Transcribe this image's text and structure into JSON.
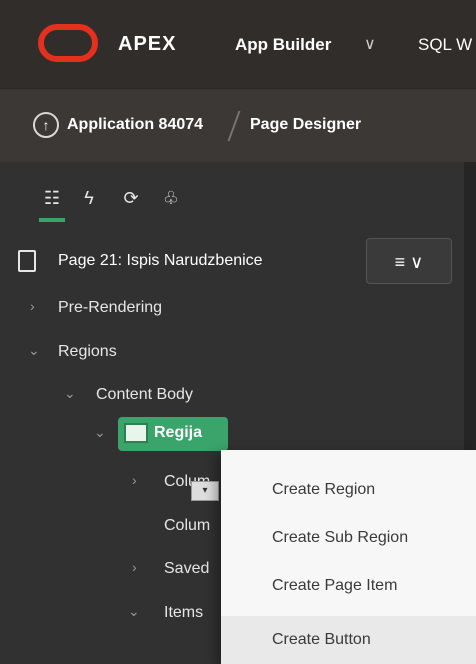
{
  "topbar": {
    "product": "APEX",
    "app_builder": "App Builder",
    "app_builder_chevron": "∨",
    "sql": "SQL W"
  },
  "breadcrumb": {
    "up_symbol": "↑",
    "application": "Application 84074",
    "current": "Page Designer"
  },
  "tabs": [
    {
      "icon": "rendering-tree-icon",
      "glyph": "☷"
    },
    {
      "icon": "dynamic-actions-icon",
      "glyph": "ϟ"
    },
    {
      "icon": "processing-icon",
      "glyph": "⟳"
    },
    {
      "icon": "shared-components-icon",
      "glyph": "♧"
    }
  ],
  "tree": {
    "page_title": "Page 21: Ispis Narudzbenice",
    "menu_button_glyph": "≡ ∨",
    "pre_rendering": "Pre-Rendering",
    "regions": "Regions",
    "content_body": "Content Body",
    "region_name": "Regija",
    "columns": "Colum",
    "columns2": "Colum",
    "saved": "Saved",
    "items": "Items"
  },
  "context_menu": {
    "items": [
      "Create Region",
      "Create Sub Region",
      "Create Page Item",
      "Create Button"
    ]
  },
  "colors": {
    "accent_green": "#3aa46b",
    "oracle_red": "#e4301e"
  }
}
